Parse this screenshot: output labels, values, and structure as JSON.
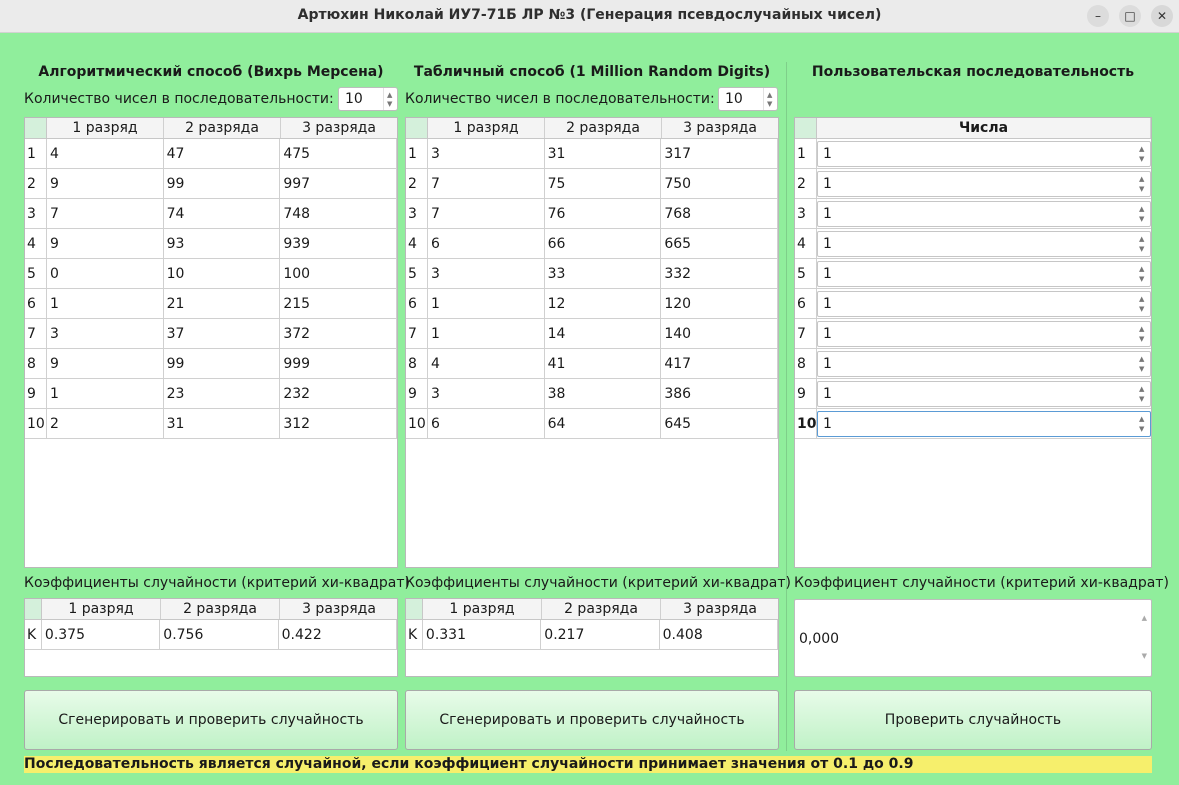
{
  "window": {
    "title": "Артюхин Николай ИУ7-71Б ЛР №3 (Генерация псевдослучайных чисел)",
    "min": "–",
    "max": "□",
    "close": "✕"
  },
  "left": {
    "heading": "Алгоритмический способ (Вихрь Мерсена)",
    "count_label": "Количество чисел в последовательности:",
    "count_value": "10",
    "columns": [
      "1 разряд",
      "2 разряда",
      "3 разряда"
    ],
    "rows": [
      [
        "4",
        "47",
        "475"
      ],
      [
        "9",
        "99",
        "997"
      ],
      [
        "7",
        "74",
        "748"
      ],
      [
        "9",
        "93",
        "939"
      ],
      [
        "0",
        "10",
        "100"
      ],
      [
        "1",
        "21",
        "215"
      ],
      [
        "3",
        "37",
        "372"
      ],
      [
        "9",
        "99",
        "999"
      ],
      [
        "1",
        "23",
        "232"
      ],
      [
        "2",
        "31",
        "312"
      ]
    ],
    "coef_label": "Коэффициенты случайности (критерий хи-квадрат)",
    "coef_row_header": "K",
    "coef_values": [
      "0.375",
      "0.756",
      "0.422"
    ],
    "button": "Сгенерировать и проверить случайность"
  },
  "middle": {
    "heading": "Табличный способ (1 Million Random Digits)",
    "count_label": "Количество чисел в последовательности:",
    "count_value": "10",
    "columns": [
      "1 разряд",
      "2 разряда",
      "3 разряда"
    ],
    "rows": [
      [
        "3",
        "31",
        "317"
      ],
      [
        "7",
        "75",
        "750"
      ],
      [
        "7",
        "76",
        "768"
      ],
      [
        "6",
        "66",
        "665"
      ],
      [
        "3",
        "33",
        "332"
      ],
      [
        "1",
        "12",
        "120"
      ],
      [
        "1",
        "14",
        "140"
      ],
      [
        "4",
        "41",
        "417"
      ],
      [
        "3",
        "38",
        "386"
      ],
      [
        "6",
        "64",
        "645"
      ]
    ],
    "coef_label": "Коэффициенты случайности  (критерий хи-квадрат)",
    "coef_row_header": "K",
    "coef_values": [
      "0.331",
      "0.217",
      "0.408"
    ],
    "button": "Сгенерировать и проверить случайность"
  },
  "right": {
    "heading": "Пользовательская последовательность",
    "column": "Числа",
    "values": [
      "1",
      "1",
      "1",
      "1",
      "1",
      "1",
      "1",
      "1",
      "1",
      "1"
    ],
    "coef_label": "Коэффициент случайности  (критерий хи-квадрат)",
    "coef_value": "0,000",
    "button": "Проверить случайность"
  },
  "row_numbers": [
    "1",
    "2",
    "3",
    "4",
    "5",
    "6",
    "7",
    "8",
    "9",
    "10"
  ],
  "note": "Последовательность является случайной, если коэффициент случайности принимает значения от 0.1 до 0.9"
}
